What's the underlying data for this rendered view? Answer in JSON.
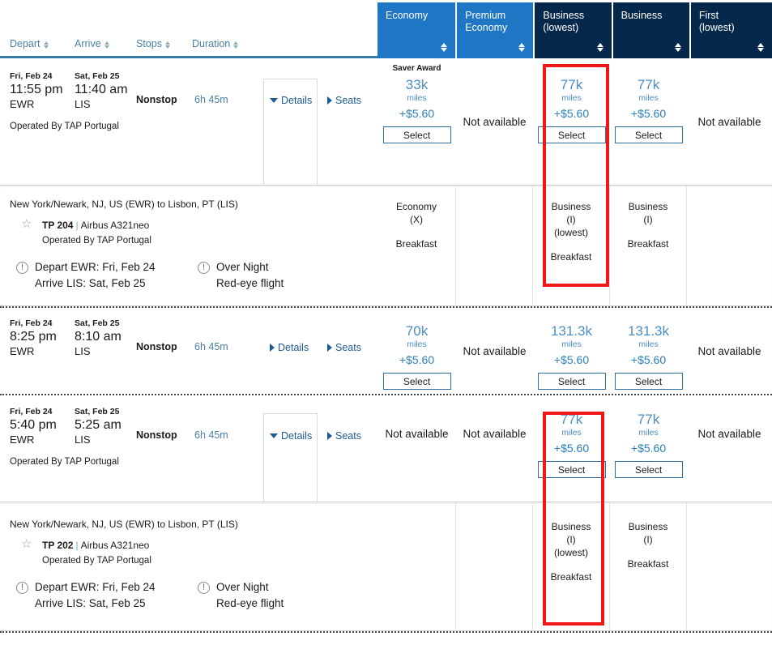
{
  "sort_headers": [
    {
      "label": "Depart",
      "icon": "sort-icon"
    },
    {
      "label": "Arrive",
      "icon": "sort-icon"
    },
    {
      "label": "Stops",
      "icon": "sort-icon"
    },
    {
      "label": "Duration",
      "icon": "sort-icon"
    }
  ],
  "cabin_tabs": [
    {
      "label": "Economy",
      "theme": "light"
    },
    {
      "label": "Premium\nEconomy",
      "theme": "light"
    },
    {
      "label": "Business\n(lowest)",
      "theme": "dark"
    },
    {
      "label": "Business",
      "theme": "dark"
    },
    {
      "label": "First\n(lowest)",
      "theme": "dark"
    }
  ],
  "links": {
    "details": "Details",
    "seats": "Seats"
  },
  "labels": {
    "select": "Select",
    "not_available": "Not available",
    "saver_award": "Saver Award",
    "miles": "miles",
    "breakfast": "Breakfast"
  },
  "colors": {
    "tab_light": "#1f76c4",
    "tab_dark": "#06294b",
    "link": "#1c5a93",
    "miles": "#4a8ec2",
    "annotation": "#ef1717"
  },
  "flights": [
    {
      "depart_date": "Fri, Feb 24",
      "depart_time": "11:55 pm",
      "depart_airport": "EWR",
      "arrive_date": "Sat, Feb 25",
      "arrive_time": "11:40 am",
      "arrive_airport": "LIS",
      "stops": "Nonstop",
      "duration": "6h 45m",
      "operated_by": "Operated By TAP Portugal",
      "expanded": true,
      "fares": [
        {
          "cabin": "Economy",
          "available": true,
          "badge": "Saver Award",
          "miles": "33k",
          "cash": "+$5.60"
        },
        {
          "cabin": "Premium Economy",
          "available": false,
          "badge": "",
          "miles": "",
          "cash": ""
        },
        {
          "cabin": "Business (lowest)",
          "available": true,
          "badge": "",
          "miles": "77k",
          "cash": "+$5.60",
          "highlight": true
        },
        {
          "cabin": "Business",
          "available": true,
          "badge": "",
          "miles": "77k",
          "cash": "+$5.60"
        },
        {
          "cabin": "First (lowest)",
          "available": false,
          "badge": "",
          "miles": "",
          "cash": ""
        }
      ]
    },
    {
      "depart_date": "Fri, Feb 24",
      "depart_time": "8:25 pm",
      "depart_airport": "EWR",
      "arrive_date": "Sat, Feb 25",
      "arrive_time": "8:10 am",
      "arrive_airport": "LIS",
      "stops": "Nonstop",
      "duration": "6h 45m",
      "operated_by": "",
      "expanded": false,
      "fares": [
        {
          "cabin": "Economy",
          "available": true,
          "badge": "",
          "miles": "70k",
          "cash": "+$5.60"
        },
        {
          "cabin": "Premium Economy",
          "available": false,
          "badge": "",
          "miles": "",
          "cash": ""
        },
        {
          "cabin": "Business (lowest)",
          "available": true,
          "badge": "",
          "miles": "131.3k",
          "cash": "+$5.60"
        },
        {
          "cabin": "Business",
          "available": true,
          "badge": "",
          "miles": "131.3k",
          "cash": "+$5.60"
        },
        {
          "cabin": "First (lowest)",
          "available": false,
          "badge": "",
          "miles": "",
          "cash": ""
        }
      ]
    },
    {
      "depart_date": "Fri, Feb 24",
      "depart_time": "5:40 pm",
      "depart_airport": "EWR",
      "arrive_date": "Sat, Feb 25",
      "arrive_time": "5:25 am",
      "arrive_airport": "LIS",
      "stops": "Nonstop",
      "duration": "6h 45m",
      "operated_by": "Operated By TAP Portugal",
      "expanded": true,
      "fares": [
        {
          "cabin": "Economy",
          "available": false,
          "badge": "",
          "miles": "",
          "cash": ""
        },
        {
          "cabin": "Premium Economy",
          "available": false,
          "badge": "",
          "miles": "",
          "cash": ""
        },
        {
          "cabin": "Business (lowest)",
          "available": true,
          "badge": "",
          "miles": "77k",
          "cash": "+$5.60",
          "highlight": true
        },
        {
          "cabin": "Business",
          "available": true,
          "badge": "",
          "miles": "77k",
          "cash": "+$5.60"
        },
        {
          "cabin": "First (lowest)",
          "available": false,
          "badge": "",
          "miles": "",
          "cash": ""
        }
      ]
    }
  ],
  "detail_panels": [
    {
      "route": "New York/Newark, NJ, US (EWR) to Lisbon, PT (LIS)",
      "flight_number": "TP 204",
      "aircraft": "Airbus A321neo",
      "operated_by": "Operated By TAP Portugal",
      "notes": [
        {
          "line1": "Depart EWR: Fri, Feb 24",
          "line2": "Arrive LIS: Sat, Feb 25"
        },
        {
          "line1": "Over Night",
          "line2": "Red-eye flight"
        }
      ],
      "fare_details": [
        {
          "name": "Economy",
          "code": "(X)",
          "lowest": "",
          "meal": "Breakfast"
        },
        {
          "name": "",
          "code": "",
          "lowest": "",
          "meal": ""
        },
        {
          "name": "Business",
          "code": "(I)",
          "lowest": "(lowest)",
          "meal": "Breakfast",
          "highlight": true
        },
        {
          "name": "Business",
          "code": "(I)",
          "lowest": "",
          "meal": "Breakfast"
        },
        {
          "name": "",
          "code": "",
          "lowest": "",
          "meal": ""
        }
      ]
    },
    {
      "route": "New York/Newark, NJ, US (EWR) to Lisbon, PT (LIS)",
      "flight_number": "TP 202",
      "aircraft": "Airbus A321neo",
      "operated_by": "Operated By TAP Portugal",
      "notes": [
        {
          "line1": "Depart EWR: Fri, Feb 24",
          "line2": "Arrive LIS: Sat, Feb 25"
        },
        {
          "line1": "Over Night",
          "line2": "Red-eye flight"
        }
      ],
      "fare_details": [
        {
          "name": "",
          "code": "",
          "lowest": "",
          "meal": ""
        },
        {
          "name": "",
          "code": "",
          "lowest": "",
          "meal": ""
        },
        {
          "name": "Business",
          "code": "(I)",
          "lowest": "(lowest)",
          "meal": "Breakfast",
          "highlight": true
        },
        {
          "name": "Business",
          "code": "(I)",
          "lowest": "",
          "meal": "Breakfast"
        },
        {
          "name": "",
          "code": "",
          "lowest": "",
          "meal": ""
        }
      ]
    }
  ]
}
